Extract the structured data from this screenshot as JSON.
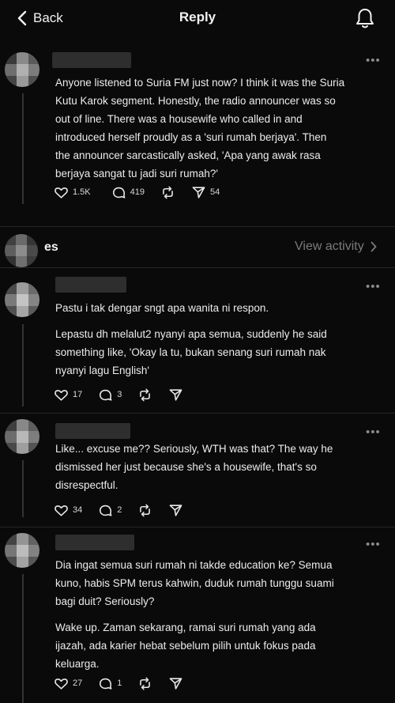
{
  "header": {
    "back_label": "Back",
    "title": "Reply"
  },
  "original_post": {
    "text_lines": [
      "Anyone listened to Suria FM just now? I think it was the Suria",
      "Kutu Karok segment. Honestly, the radio announcer was so",
      "out of line. There was a housewife who called in and",
      "introduced herself proudly as a 'suri rumah berjaya'. Then",
      "the announcer sarcastically asked, 'Apa yang awak rasa",
      "berjaya sangat tu jadi suri rumah?'"
    ],
    "likes": "1.5K",
    "comments": "419",
    "shares": "54"
  },
  "section": {
    "label": "es",
    "view_activity": "View activity"
  },
  "replies": [
    {
      "paragraphs": [
        [
          "Pastu i tak dengar sngt apa wanita ni respon."
        ],
        [
          "Lepastu dh melalut2 nyanyi apa semua, suddenly he said",
          "something like, 'Okay la tu, bukan senang suri rumah nak",
          "nyanyi lagu English'"
        ]
      ],
      "likes": "17",
      "comments": "3"
    },
    {
      "paragraphs": [
        [
          "Like... excuse me?? Seriously, WTH was that? The way he",
          "dismissed her just because she's a housewife, that's so",
          "disrespectful."
        ]
      ],
      "likes": "34",
      "comments": "2"
    },
    {
      "paragraphs": [
        [
          "Dia ingat semua suri rumah ni takde education ke? Semua",
          "kuno, habis SPM terus kahwin, duduk rumah tunggu suami",
          "bagi duit? Seriously?"
        ],
        [
          "Wake up. Zaman sekarang, ramai suri rumah yang ada",
          "ijazah, ada karier hebat sebelum pilih untuk fokus pada",
          "keluarga."
        ]
      ],
      "likes": "27",
      "comments": "1"
    }
  ],
  "icons": {
    "back": "chevron-left-icon",
    "notifications": "bell-icon",
    "like": "heart-icon",
    "comment": "comment-icon",
    "repost": "repost-icon",
    "share": "send-icon",
    "more": "more-dots-icon"
  },
  "colors": {
    "background": "#0a0a0a",
    "text": "#ececec",
    "muted": "#7a7a7a"
  }
}
